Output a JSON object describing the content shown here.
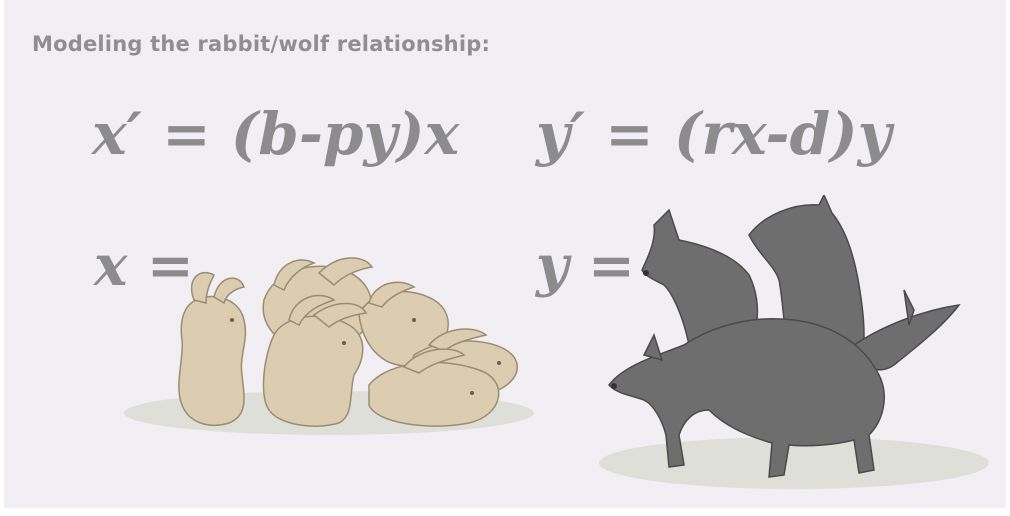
{
  "heading": "Modeling the rabbit/wolf relationship:",
  "equations": {
    "rabbit": "x′ = (b-py)x",
    "wolf": "y′ = (rx-d)y"
  },
  "variables": {
    "x_label": "x =",
    "y_label": "y ="
  },
  "illustrations": {
    "rabbits": "rabbit-group",
    "wolves": "wolf-pack"
  },
  "colors": {
    "background": "#f1eff4",
    "text": "#8c8c8c",
    "rabbit_fill": "#dcccb0",
    "wolf_fill": "#6e6e6e",
    "shadow": "#dedfd8"
  }
}
